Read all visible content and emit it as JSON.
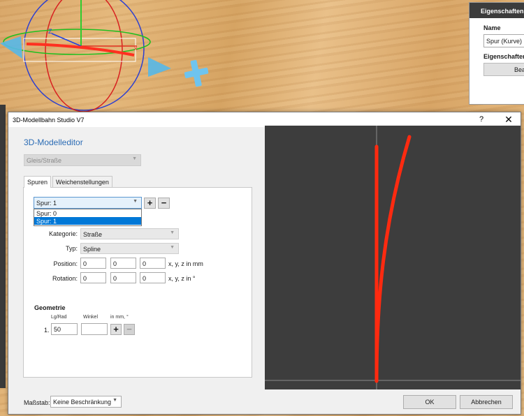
{
  "props_panel": {
    "header": "Eigenschaften",
    "name_label": "Name",
    "name_value": "Spur (Kurve)",
    "props_label": "Eigenschaften",
    "edit_button": "Bea"
  },
  "dialog": {
    "title": "3D-Modellbahn Studio V7",
    "help": "?",
    "close": "✕",
    "editor_heading": "3D-Modelleditor",
    "type_combo": "Gleis/Straße",
    "tabs": [
      {
        "label": "Spuren",
        "active": true
      },
      {
        "label": "Weichenstellungen",
        "active": false
      }
    ],
    "track_select": {
      "value": "Spur: 1",
      "options": [
        "Spur: 0",
        "Spur: 1"
      ],
      "selected_index": 1
    },
    "add_label": "+",
    "remove_label": "−",
    "fields": {
      "category_label": "Kategorie:",
      "category_value": "Straße",
      "type_label": "Typ:",
      "type_value": "Spline",
      "position_label": "Position:",
      "position_values": [
        "0",
        "0",
        "0"
      ],
      "position_unit": "x, y, z in mm",
      "rotation_label": "Rotation:",
      "rotation_values": [
        "0",
        "0",
        "0"
      ],
      "rotation_unit": "x, y, z in °"
    },
    "geometry": {
      "title": "Geometrie",
      "col_length": "Lg/Rad",
      "col_angle": "Winkel",
      "col_units": "in mm, °",
      "rows": [
        {
          "index": "1.",
          "length": "50",
          "angle": ""
        }
      ]
    },
    "bottom": {
      "scale_label": "Maßstab:",
      "scale_value": "Keine Beschränkung",
      "ok": "OK",
      "cancel": "Abbrechen"
    }
  },
  "colors": {
    "accent": "#2b6cb5",
    "track_red": "#ff2a10",
    "viewport_bg": "#3d3d3d",
    "selection_blue": "#0078d7"
  }
}
